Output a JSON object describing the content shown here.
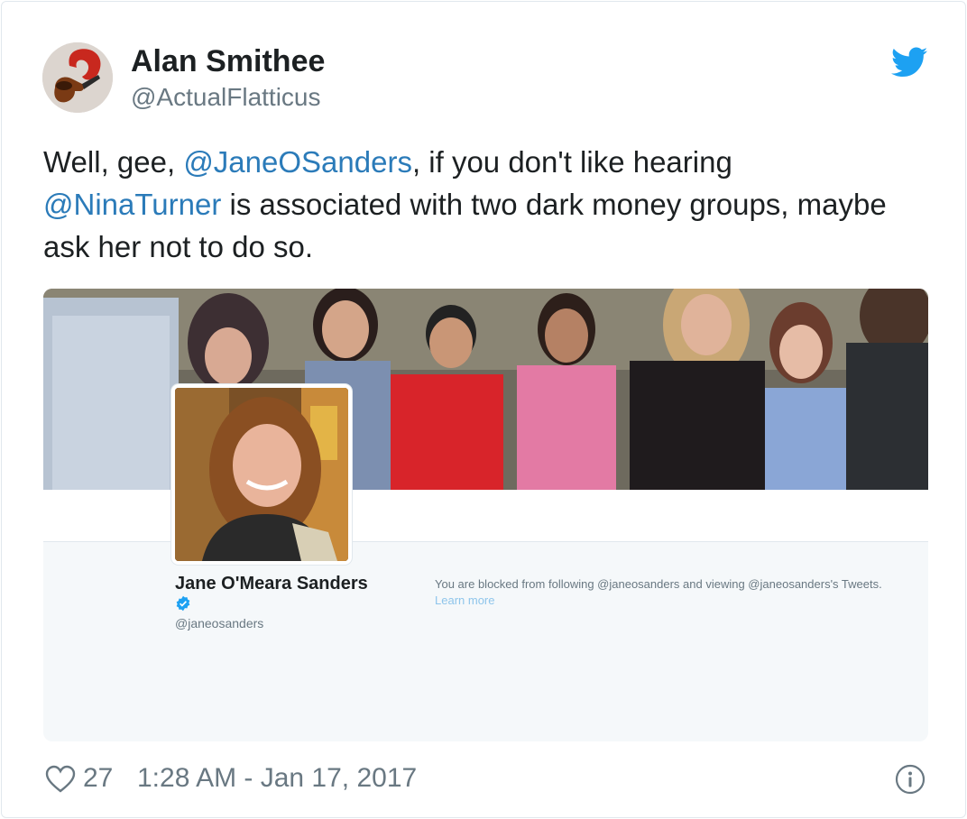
{
  "author": {
    "name": "Alan Smithee",
    "handle": "@ActualFlatticus"
  },
  "tweet": {
    "parts": [
      {
        "text": "Well, gee, ",
        "mention": false
      },
      {
        "text": "@JaneOSanders",
        "mention": true
      },
      {
        "text": ", if you don't like hearing ",
        "mention": false
      },
      {
        "text": "@NinaTurner",
        "mention": true
      },
      {
        "text": " is associated with two dark money groups, maybe ask her not to do so.",
        "mention": false
      }
    ]
  },
  "profile_card": {
    "name": "Jane O'Meara Sanders",
    "handle": "@janeosanders",
    "verified": true,
    "blocked_message": "You are blocked from following @janeosanders and viewing @janeosanders's Tweets.",
    "learn_more": "Learn more"
  },
  "footer": {
    "like_count": "27",
    "timestamp": "1:28 AM - Jan 17, 2017"
  },
  "colors": {
    "mention": "#2b7bb9",
    "twitter_blue": "#1da1f2",
    "muted": "#697882",
    "card_bg": "#f5f8fa"
  },
  "icons": [
    "twitter-bird-icon",
    "verified-badge-icon",
    "heart-icon",
    "info-icon"
  ]
}
